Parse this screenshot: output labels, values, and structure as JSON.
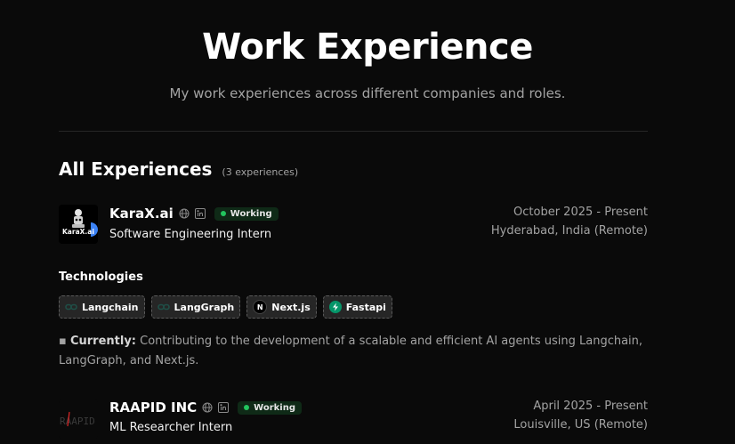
{
  "header": {
    "title": "Work Experience",
    "subtitle": "My work experiences across different companies and roles."
  },
  "section": {
    "title": "All Experiences",
    "count": "(3 experiences)"
  },
  "experiences": [
    {
      "company": "KaraX.ai",
      "logo_text": "KaraX.ai",
      "status": "Working",
      "role": "Software Engineering Intern",
      "dates": "October 2025 - Present",
      "location": "Hyderabad, India (Remote)",
      "technologies_heading": "Technologies",
      "technologies": [
        {
          "name": "Langchain",
          "icon": "langchain-icon"
        },
        {
          "name": "LangGraph",
          "icon": "langgraph-icon"
        },
        {
          "name": "Next.js",
          "icon": "nextjs-icon"
        },
        {
          "name": "Fastapi",
          "icon": "fastapi-icon"
        }
      ],
      "description_label": "Currently:",
      "description_text": "Contributing to the development of a scalable and efficient AI agents using Langchain, LangGraph, and Next.js."
    },
    {
      "company": "RAAPID INC",
      "logo_text": "RAAPID",
      "status": "Working",
      "role": "ML Researcher Intern",
      "dates": "April 2025 - Present",
      "location": "Louisville, US (Remote)"
    }
  ],
  "colors": {
    "background": "#0a0a0a",
    "status_dot": "#22c55e",
    "badge_bg": "#0f2a17",
    "muted_text": "#a3a3a3"
  }
}
